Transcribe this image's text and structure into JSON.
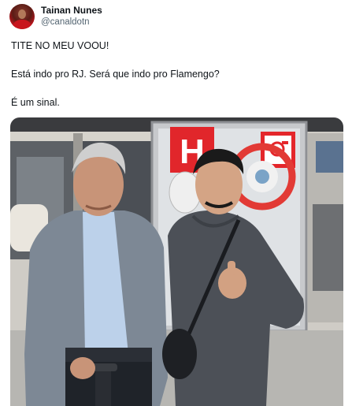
{
  "author": {
    "display_name": "Tainan Nunes",
    "handle": "@canaldotn"
  },
  "tweet": {
    "lines": [
      "TITE NO MEU VOOU!",
      "Está indo pro RJ. Será que indo pro Flamengo?",
      "É um sinal."
    ]
  },
  "media": {
    "sign_letter": "H"
  },
  "icons": {
    "avatar": "user-avatar",
    "fire_hose": "fire-hose-icon"
  }
}
